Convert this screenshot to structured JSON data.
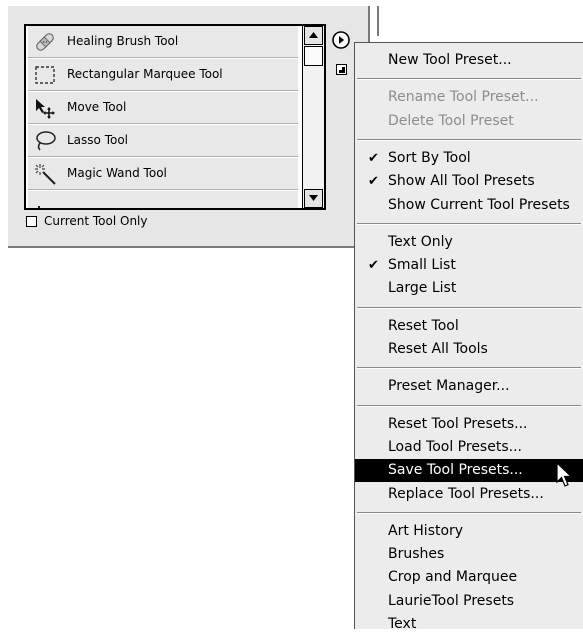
{
  "palette": {
    "items": [
      {
        "label": "Healing Brush Tool",
        "icon": "healing-brush-icon"
      },
      {
        "label": "Rectangular Marquee Tool",
        "icon": "rectangular-marquee-icon"
      },
      {
        "label": "Move Tool",
        "icon": "move-tool-icon"
      },
      {
        "label": "Lasso Tool",
        "icon": "lasso-icon"
      },
      {
        "label": "Magic Wand Tool",
        "icon": "magic-wand-icon"
      }
    ],
    "current_tool_only_label": "Current Tool Only",
    "current_tool_only_checked": false
  },
  "menu": {
    "groups": [
      [
        {
          "label": "New Tool Preset...",
          "checked": false,
          "disabled": false,
          "selected": false
        }
      ],
      [
        {
          "label": "Rename Tool Preset...",
          "checked": false,
          "disabled": true,
          "selected": false
        },
        {
          "label": "Delete Tool Preset",
          "checked": false,
          "disabled": true,
          "selected": false
        }
      ],
      [
        {
          "label": "Sort By Tool",
          "checked": true,
          "disabled": false,
          "selected": false
        },
        {
          "label": "Show All Tool Presets",
          "checked": true,
          "disabled": false,
          "selected": false
        },
        {
          "label": "Show Current Tool Presets",
          "checked": false,
          "disabled": false,
          "selected": false
        }
      ],
      [
        {
          "label": "Text Only",
          "checked": false,
          "disabled": false,
          "selected": false
        },
        {
          "label": "Small List",
          "checked": true,
          "disabled": false,
          "selected": false
        },
        {
          "label": "Large List",
          "checked": false,
          "disabled": false,
          "selected": false
        }
      ],
      [
        {
          "label": "Reset Tool",
          "checked": false,
          "disabled": false,
          "selected": false
        },
        {
          "label": "Reset All Tools",
          "checked": false,
          "disabled": false,
          "selected": false
        }
      ],
      [
        {
          "label": "Preset Manager...",
          "checked": false,
          "disabled": false,
          "selected": false
        }
      ],
      [
        {
          "label": "Reset Tool Presets...",
          "checked": false,
          "disabled": false,
          "selected": false
        },
        {
          "label": "Load Tool Presets...",
          "checked": false,
          "disabled": false,
          "selected": false
        },
        {
          "label": "Save Tool Presets...",
          "checked": false,
          "disabled": false,
          "selected": true
        },
        {
          "label": "Replace Tool Presets...",
          "checked": false,
          "disabled": false,
          "selected": false
        }
      ],
      [
        {
          "label": "Art History",
          "checked": false,
          "disabled": false,
          "selected": false
        },
        {
          "label": "Brushes",
          "checked": false,
          "disabled": false,
          "selected": false
        },
        {
          "label": "Crop and Marquee",
          "checked": false,
          "disabled": false,
          "selected": false
        },
        {
          "label": "LaurieTool Presets",
          "checked": false,
          "disabled": false,
          "selected": false
        },
        {
          "label": "Text",
          "checked": false,
          "disabled": false,
          "selected": false
        }
      ]
    ],
    "check_glyph": "✔",
    "highlight_color": "#000000",
    "disabled_color": "#8c8c8c"
  }
}
